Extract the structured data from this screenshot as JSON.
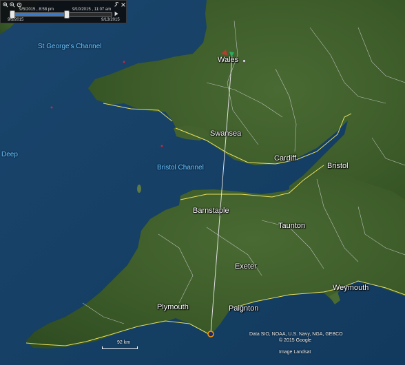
{
  "timeslider": {
    "start_time": "9/5/2015 , 8:58 pm",
    "end_time": "9/10/2015 , 11:07 am",
    "range_start": "9/5/2015",
    "range_end": "9/13/2015",
    "progress": 0.55,
    "icons": [
      "zoom-in-icon",
      "zoom-out-icon",
      "clock-settings-icon",
      "wrench-icon",
      "close-icon"
    ]
  },
  "labels": {
    "wales": "Wales",
    "st_georges_channel": "St George's Channel",
    "swansea": "Swansea",
    "cardiff": "Cardiff",
    "bristol": "Bristol",
    "bristol_channel": "Bristol Channel",
    "deep": "Deep",
    "barnstaple": "Barnstaple",
    "taunton": "Taunton",
    "exeter": "Exeter",
    "weymouth": "Weymouth",
    "plymouth": "Plymouth",
    "paignton": "Paignton"
  },
  "scale_label": "92 km",
  "attribution": {
    "data": "Data SIO, NOAA, U.S. Navy, NGA, GEBCO",
    "copyright": "© 2015 Google",
    "image": "Image Landsat"
  },
  "colors": {
    "sea": "#1c4a73",
    "land": "#3f5f2c",
    "border": "#e8e060",
    "track_line": "#e0e0e0",
    "timeslider_fill": "#3a78c9"
  }
}
